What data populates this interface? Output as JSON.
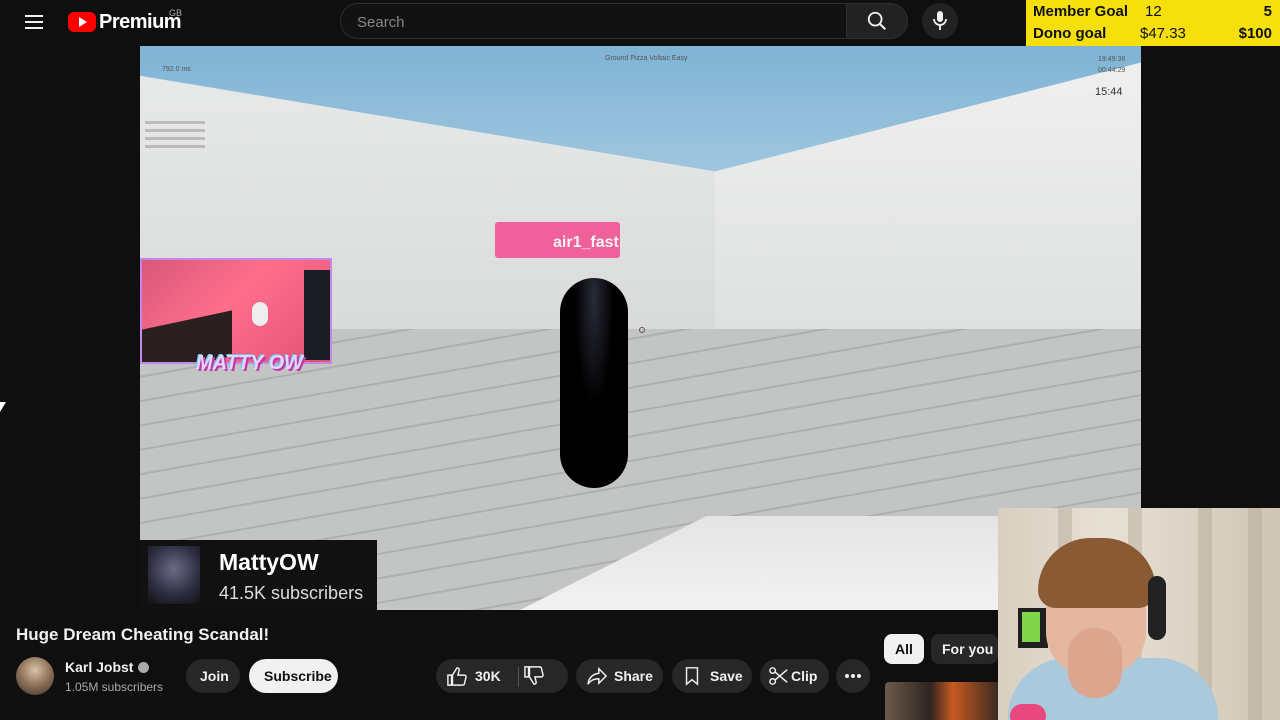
{
  "header": {
    "logo_text": "Premium",
    "country": "GB",
    "search_placeholder": "Search"
  },
  "goals": {
    "member_label": "Member Goal",
    "member_current": "12",
    "member_target": "5",
    "dono_label": "Dono goal",
    "dono_current": "$47.33",
    "dono_target": "$100"
  },
  "game": {
    "player_tag": "air1_fast",
    "timer": "15:44",
    "hud_top_center": "Ground Pizza Voltaic Easy",
    "hud_top_left": "792.0 ms",
    "hud_clock_1": "19:49:36",
    "hud_clock_2": "00:44:29",
    "facecam_logo": "MATTY OW"
  },
  "channel_card": {
    "name": "MattyOW",
    "subscribers": "41.5K subscribers"
  },
  "video": {
    "title": "Huge Dream Cheating Scandal!",
    "owner_name": "Karl Jobst",
    "owner_subscribers": "1.05M subscribers",
    "join_label": "Join",
    "subscribe_label": "Subscribe",
    "like_count": "30K",
    "share_label": "Share",
    "save_label": "Save",
    "clip_label": "Clip"
  },
  "chips": {
    "all_label": "All",
    "for_you_label": "For you"
  },
  "colors": {
    "accent_red": "#ff0000",
    "goal_bg": "#f5e00d",
    "nametag": "#f0609a"
  }
}
